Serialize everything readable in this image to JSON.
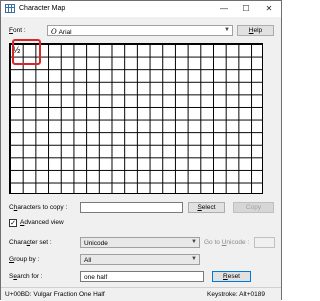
{
  "window": {
    "title": "Character Map",
    "minimize": "—",
    "maximize": "☐",
    "close": "✕"
  },
  "font": {
    "label": "Font :",
    "label_hotkey": "F",
    "label_rest": "ont :",
    "value": "Arial",
    "icon": "opentype-icon",
    "help": "Help",
    "help_hotkey": "H",
    "help_rest": "elp"
  },
  "grid": {
    "selected_char": "½"
  },
  "copy_row": {
    "label_hotkey": "h",
    "label_pre": "C",
    "label_post": "aracters to copy :",
    "value": "",
    "select": "Select",
    "select_hotkey": "S",
    "select_rest": "elect",
    "copy": "Copy"
  },
  "advanced": {
    "checked": "✓",
    "label_hotkey": "A",
    "label_rest": "dvanced view"
  },
  "charset": {
    "label_pre": "Chara",
    "label_hotkey": "c",
    "label_post": "ter set :",
    "value": "Unicode",
    "goto_label_pre": "Go to ",
    "goto_hotkey": "U",
    "goto_label_post": "nicode :"
  },
  "groupby": {
    "label_hotkey": "G",
    "label_rest": "roup by :",
    "value": "All"
  },
  "search": {
    "label_pre": "S",
    "label_hotkey": "e",
    "label_post": "arch for :",
    "value": "one half",
    "reset_hotkey": "R",
    "reset_rest": "eset"
  },
  "status": {
    "left": "U+00BD: Vulgar Fraction One Half",
    "right": "Keystroke: Alt+0189"
  }
}
